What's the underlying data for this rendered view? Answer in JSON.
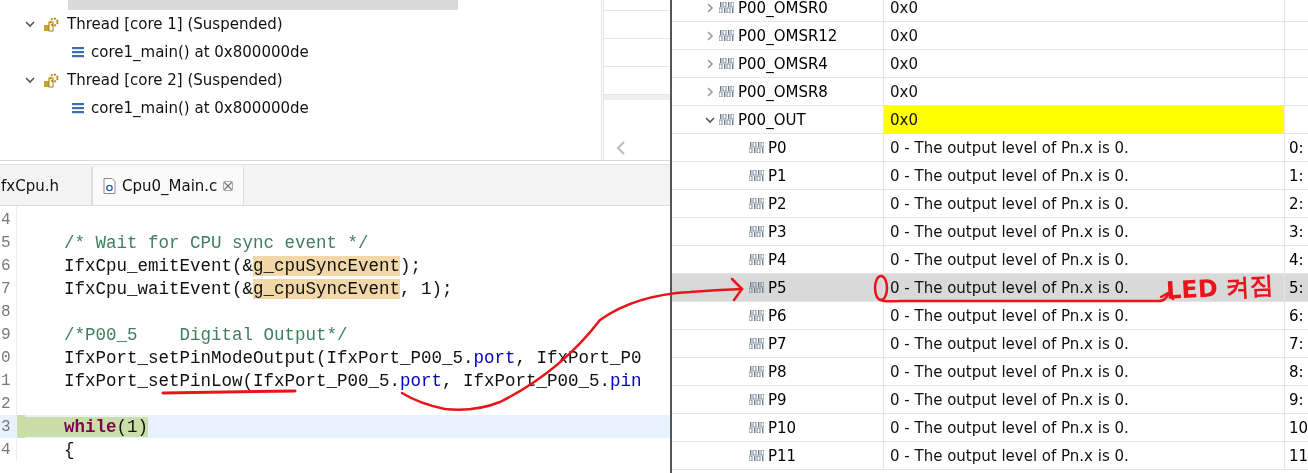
{
  "debug_view": {
    "clipped_row": {
      "selected": true
    },
    "items": [
      {
        "label": "Thread [core 1] (Suspended)",
        "kind": "thread",
        "expanded": true,
        "children": [
          {
            "label": "core1_main() at 0x800000de",
            "kind": "frame"
          }
        ]
      },
      {
        "label": "Thread [core 2] (Suspended)",
        "kind": "thread",
        "expanded": true,
        "children": [
          {
            "label": "core1_main() at 0x800000de",
            "kind": "frame"
          }
        ]
      }
    ]
  },
  "editor": {
    "tabs": [
      {
        "label": "fxCpu.h",
        "selected": false,
        "closable": false
      },
      {
        "label": "Cpu0_Main.c",
        "selected": true,
        "closable": true
      }
    ],
    "lines": [
      {
        "number": "4",
        "current": false
      },
      {
        "number": "5",
        "current": false,
        "tokens": [
          {
            "kind": "comment",
            "text": "/* Wait for CPU sync event */"
          }
        ]
      },
      {
        "number": "6",
        "current": false,
        "tokens": [
          {
            "kind": "plain",
            "text": "IfxCpu_emitEvent(&"
          },
          {
            "kind": "occurrence",
            "text": "g_cpuSyncEvent"
          },
          {
            "kind": "plain",
            "text": ");"
          }
        ]
      },
      {
        "number": "7",
        "current": false,
        "tokens": [
          {
            "kind": "plain",
            "text": "IfxCpu_waitEvent(&"
          },
          {
            "kind": "occurrence",
            "text": "g_cpuSyncEvent"
          },
          {
            "kind": "plain",
            "text": ", 1);"
          }
        ]
      },
      {
        "number": "8",
        "current": false
      },
      {
        "number": "9",
        "current": false,
        "tokens": [
          {
            "kind": "comment",
            "text": "/*P00_5    Digital Output*/"
          }
        ]
      },
      {
        "number": "0",
        "current": false,
        "tokens": [
          {
            "kind": "plain",
            "text": "IfxPort_setPinModeOutput(IfxPort_P00_5."
          },
          {
            "kind": "field",
            "text": "port"
          },
          {
            "kind": "plain",
            "text": ", IfxPort_P0"
          }
        ]
      },
      {
        "number": "1",
        "current": false,
        "tokens": [
          {
            "kind": "plain",
            "text": "IfxPort_setPinLow(IfxPort_P00_5."
          },
          {
            "kind": "field",
            "text": "port"
          },
          {
            "kind": "plain",
            "text": ", IfxPort_P00_5."
          },
          {
            "kind": "field",
            "text": "pin"
          }
        ]
      },
      {
        "number": "2",
        "current": false
      },
      {
        "number": "3",
        "current": true,
        "tokens": [
          {
            "kind": "keyword",
            "text": "while"
          },
          {
            "kind": "plain",
            "text": "(1)"
          }
        ]
      },
      {
        "number": "4",
        "current": false,
        "tokens": [
          {
            "kind": "plain",
            "text": "{"
          }
        ]
      }
    ]
  },
  "registers": {
    "rows": [
      {
        "kind": "register",
        "name": "P00_OMSR0",
        "value": "0x0",
        "expanded": false,
        "changed": false,
        "selected": false
      },
      {
        "kind": "register",
        "name": "P00_OMSR12",
        "value": "0x0",
        "expanded": false,
        "changed": false,
        "selected": false
      },
      {
        "kind": "register",
        "name": "P00_OMSR4",
        "value": "0x0",
        "expanded": false,
        "changed": false,
        "selected": false
      },
      {
        "kind": "register",
        "name": "P00_OMSR8",
        "value": "0x0",
        "expanded": false,
        "changed": false,
        "selected": false
      },
      {
        "kind": "register",
        "name": "P00_OUT",
        "value": "0x0",
        "expanded": true,
        "changed": true,
        "selected": false
      },
      {
        "kind": "field",
        "name": "P0",
        "value": "0 - The output level of Pn.x is 0.",
        "column_3": "0:",
        "changed": false,
        "selected": false
      },
      {
        "kind": "field",
        "name": "P1",
        "value": "0 - The output level of Pn.x is 0.",
        "column_3": "1:",
        "changed": false,
        "selected": false
      },
      {
        "kind": "field",
        "name": "P2",
        "value": "0 - The output level of Pn.x is 0.",
        "column_3": "2:",
        "changed": false,
        "selected": false
      },
      {
        "kind": "field",
        "name": "P3",
        "value": "0 - The output level of Pn.x is 0.",
        "column_3": "3:",
        "changed": false,
        "selected": false
      },
      {
        "kind": "field",
        "name": "P4",
        "value": "0 - The output level of Pn.x is 0.",
        "column_3": "4:",
        "changed": false,
        "selected": false
      },
      {
        "kind": "field",
        "name": "P5",
        "value": "0 - The output level of Pn.x is 0.",
        "column_3": "5:",
        "changed": false,
        "selected": true
      },
      {
        "kind": "field",
        "name": "P6",
        "value": "0 - The output level of Pn.x is 0.",
        "column_3": "6:",
        "changed": false,
        "selected": false
      },
      {
        "kind": "field",
        "name": "P7",
        "value": "0 - The output level of Pn.x is 0.",
        "column_3": "7:",
        "changed": false,
        "selected": false
      },
      {
        "kind": "field",
        "name": "P8",
        "value": "0 - The output level of Pn.x is 0.",
        "column_3": "8:",
        "changed": false,
        "selected": false
      },
      {
        "kind": "field",
        "name": "P9",
        "value": "0 - The output level of Pn.x is 0.",
        "column_3": "9:",
        "changed": false,
        "selected": false
      },
      {
        "kind": "field",
        "name": "P10",
        "value": "0 - The output level of Pn.x is 0.",
        "column_3": "10",
        "changed": false,
        "selected": false
      },
      {
        "kind": "field",
        "name": "P11",
        "value": "0 - The output level of Pn.x is 0.",
        "column_3": "11",
        "changed": false,
        "selected": false
      }
    ]
  },
  "annotation": {
    "note": "LED 켜짐"
  }
}
